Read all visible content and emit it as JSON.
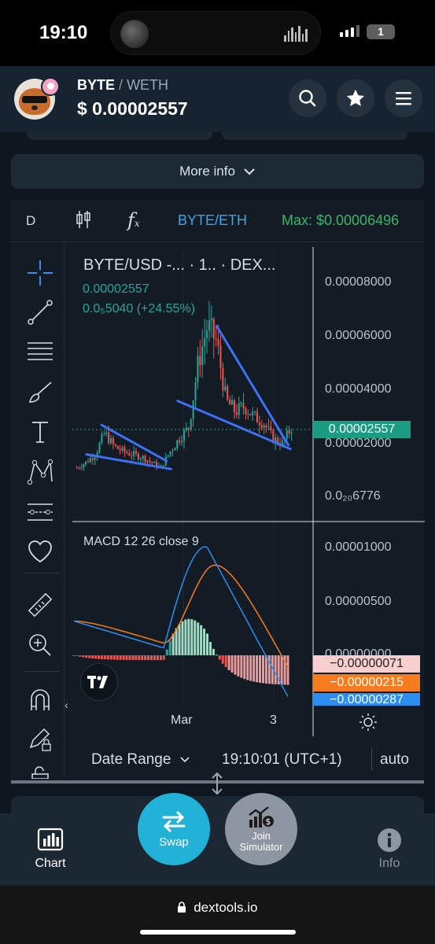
{
  "status_bar": {
    "time": "19:10",
    "notification_count": "1"
  },
  "header": {
    "base_token": "BYTE",
    "separator": "/",
    "quote_token": "WETH",
    "price": "$  0.00002557",
    "icons": [
      "search-icon",
      "star-icon",
      "menu-icon"
    ]
  },
  "more_info": {
    "label": "More info"
  },
  "chart_toolbar": {
    "interval": "D",
    "pair": "BYTE/ETH",
    "max": "Max: $0.00006496"
  },
  "chart_legend": {
    "title": "BYTE/USD -... · 1.. · DEX...",
    "price": "0.00002557",
    "change": "0.0₅5040 (+24.55%)"
  },
  "price_axis": {
    "labels": [
      "0.00008000",
      "0.00006000",
      "0.00004000",
      "0.00002000",
      "0.0₂₀6776"
    ],
    "last_price_tag": "0.00002557"
  },
  "macd": {
    "label": "MACD  12  26  close  9",
    "axis_labels": [
      "0.00001000",
      "0.00000500"
    ],
    "partial_label": "0.00000000",
    "tags": [
      {
        "text": "−0.00000071",
        "bg": "#f7cfcf",
        "fg": "#222222"
      },
      {
        "text": "−0.00000215",
        "bg": "#f57c1f",
        "fg": "#ffffff"
      },
      {
        "text": "−0.00000287",
        "bg": "#2b8ef0",
        "fg": "#ffffff"
      }
    ]
  },
  "time_axis": {
    "labels": [
      "Mar",
      "3"
    ]
  },
  "bottom_toolbar": {
    "date_range": "Date Range",
    "clock": "19:10:01 (UTC+1)",
    "scale": "auto"
  },
  "bottom_nav": {
    "chart": "Chart",
    "swap": "Swap",
    "simulator": "Join Simulator",
    "info": "Info"
  },
  "browser": {
    "url": "dextools.io"
  },
  "colors": {
    "up": "#26a69a",
    "down": "#ef5350",
    "trendline": "#3e6ff7",
    "accent": "#3ca4e8",
    "max": "#3bb46c",
    "macd_line": "#2b8ef0",
    "signal_line": "#f57c1f"
  },
  "chart_data": {
    "type": "candlestick",
    "title": "BYTE/USD -... · 1.. · DEX...",
    "x_tick_labels": [
      "Mar",
      "3"
    ],
    "y_tick_labels": [
      "0.00008000",
      "0.00006000",
      "0.00004000",
      "0.00002000",
      "0.0₂₀6776"
    ],
    "last_price": 2.557e-05,
    "ylim": [
      1e-06,
      8.5e-05
    ],
    "close_series": [
      1.1e-05,
      1.3e-05,
      1.6e-05,
      2.4e-05,
      1.9e-05,
      1.7e-05,
      1.6e-05,
      1.5e-05,
      1.3e-05,
      1.1e-05,
      1.7e-05,
      2.2e-05,
      2.6e-05,
      5e-05,
      6.4e-05,
      5.8e-05,
      3.6e-05,
      3.2e-05,
      3.4e-05,
      3e-05,
      2.8e-05,
      2.2e-05,
      2e-05,
      2.6e-05
    ]
  }
}
